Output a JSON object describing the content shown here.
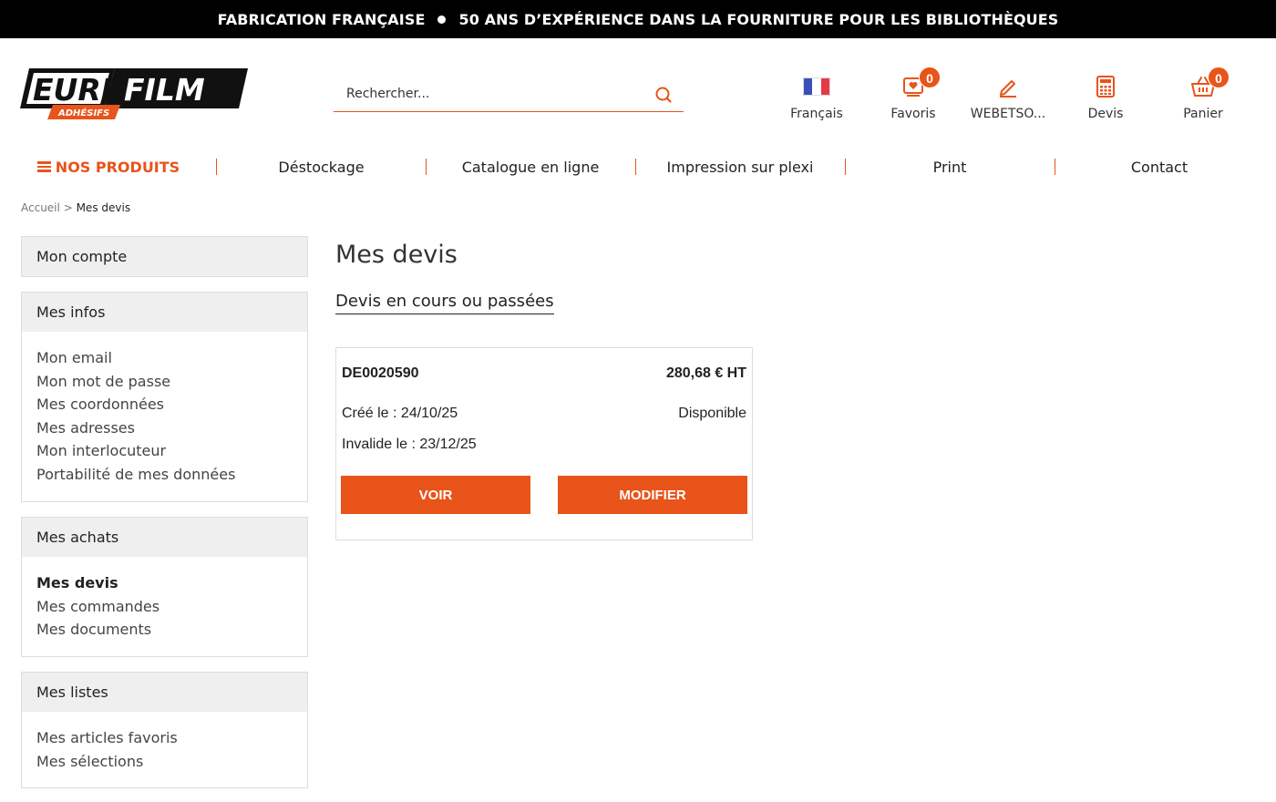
{
  "topbar": {
    "left": "FABRICATION FRANÇAISE",
    "right": "50 ANS D’EXPÉRIENCE DANS LA FOURNITURE POUR LES BIBLIOTHÈQUES"
  },
  "logo": {
    "word1": "EURE",
    "word2": "FILM",
    "sub": "ADHÉSIFS"
  },
  "search": {
    "placeholder": "Rechercher..."
  },
  "header_icons": {
    "language": "Français",
    "favorites": "Favoris",
    "favorites_count": "0",
    "account": "WEBETSO...",
    "quotes": "Devis",
    "cart": "Panier",
    "cart_count": "0"
  },
  "nav": {
    "products": "NOS PRODUITS",
    "items": [
      "Déstockage",
      "Catalogue en ligne",
      "Impression sur plexi",
      "Print",
      "Contact"
    ]
  },
  "breadcrumb": {
    "home": "Accueil",
    "separator": ">",
    "current": "Mes devis"
  },
  "sidebar": {
    "account": "Mon compte",
    "infos": {
      "title": "Mes infos",
      "items": [
        "Mon email",
        "Mon mot de passe",
        "Mes coordonnées",
        "Mes adresses",
        "Mon interlocuteur",
        "Portabilité de mes données"
      ]
    },
    "purchases": {
      "title": "Mes achats",
      "items": [
        "Mes devis",
        "Mes commandes",
        "Mes documents"
      ]
    },
    "lists": {
      "title": "Mes listes",
      "items": [
        "Mes articles favoris",
        "Mes sélections"
      ]
    }
  },
  "main": {
    "title": "Mes devis",
    "tab": "Devis en cours ou passées",
    "quote": {
      "number": "DE0020590",
      "price": "280,68 € HT",
      "created": "Créé le : 24/10/25",
      "status": "Disponible",
      "invalid": "Invalide le : 23/12/25",
      "view_label": "VOIR",
      "edit_label": "MODIFIER"
    }
  },
  "colors": {
    "accent": "#e8541a",
    "topbar_bg": "#000000",
    "panel_head": "#efefef"
  }
}
